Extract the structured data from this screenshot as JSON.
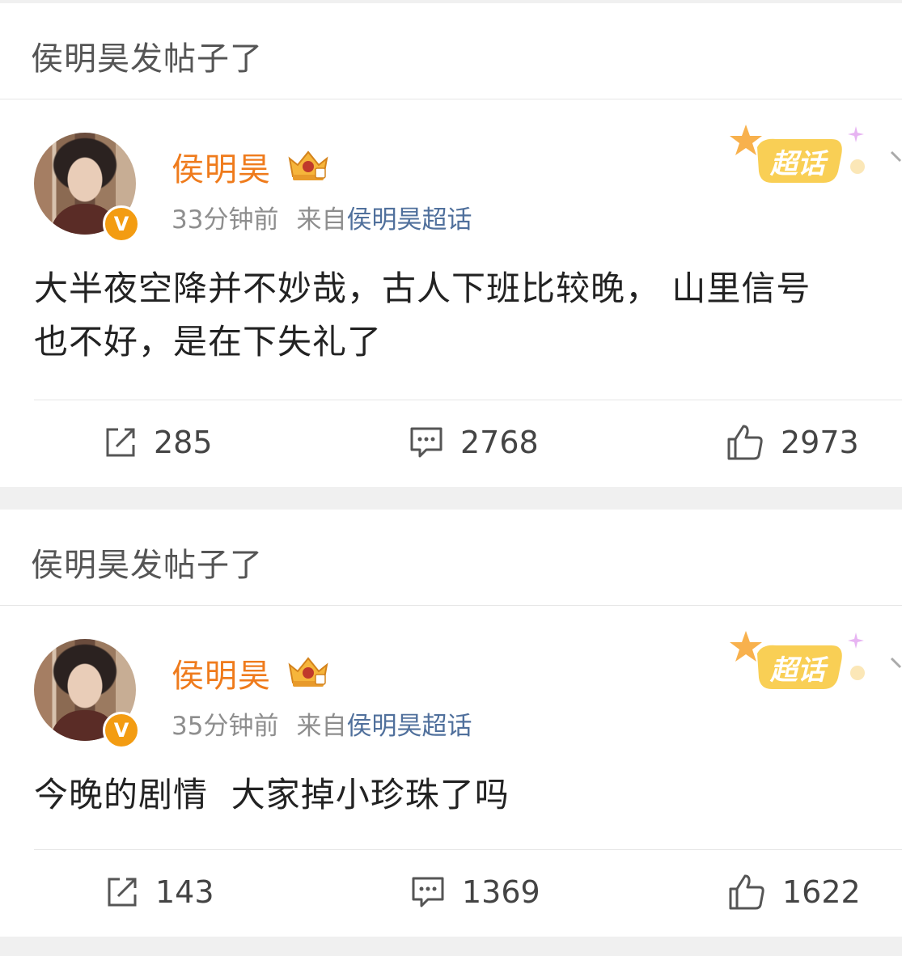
{
  "posts": [
    {
      "header_text": "侯明昊发帖子了",
      "user_name": "侯明昊",
      "verified_mark": "V",
      "time": "33分钟前",
      "source_prefix": "来自",
      "source_link": "侯明昊超话",
      "badge_text": "超话",
      "content_line1": "大半夜空降并不妙哉，古人下班比较晚， 山里信号",
      "content_line2": "也不好，是在下失礼了",
      "repost_count": "285",
      "comment_count": "2768",
      "like_count": "2973"
    },
    {
      "header_text": "侯明昊发帖子了",
      "user_name": "侯明昊",
      "verified_mark": "V",
      "time": "35分钟前",
      "source_prefix": "来自",
      "source_link": "侯明昊超话",
      "badge_text": "超话",
      "content_line1": "今晚的剧情  大家掉小珍珠了吗",
      "content_line2": "",
      "repost_count": "143",
      "comment_count": "1369",
      "like_count": "1622"
    }
  ],
  "icons": {
    "repost": "repost-icon",
    "comment": "comment-icon",
    "like": "like-icon",
    "crown": "crown-badge-icon",
    "chevron": "chevron-down-icon"
  },
  "colors": {
    "username": "#ef7b1c",
    "source_link": "#50709c",
    "verified": "#f39c12",
    "chaohua_badge": "#f8c84a"
  }
}
